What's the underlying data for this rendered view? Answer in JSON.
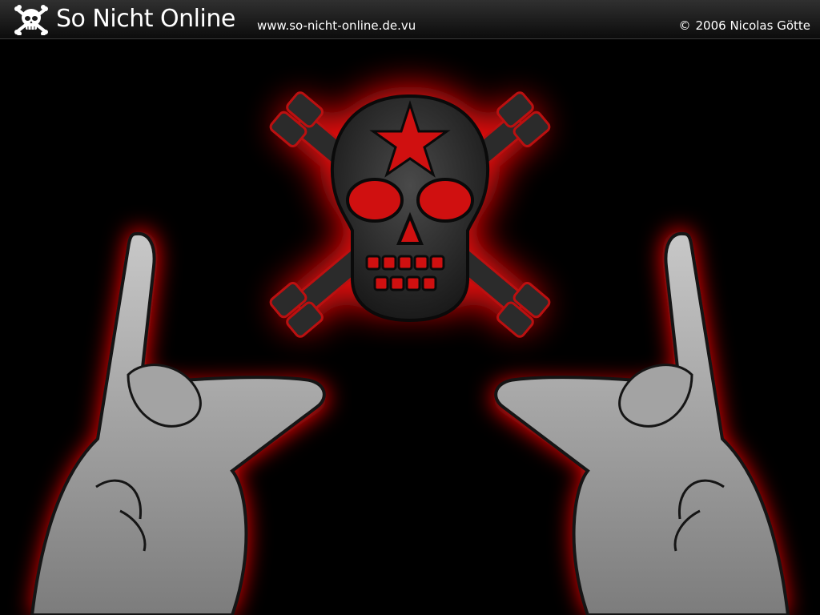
{
  "header": {
    "title": "So Nicht Online",
    "url": "www.so-nicht-online.de.vu",
    "copyright_symbol": "©",
    "copyright": "2006 Nicolas Götte",
    "logo_icon": "skull-crossbones-icon"
  },
  "artwork": {
    "icons": [
      "skull-crossbones-icon",
      "star-icon",
      "devil-horns-hand-icon"
    ],
    "colors": {
      "background": "#000000",
      "glow": "#ff1a1a",
      "skull": "#3a3a3a",
      "hand": "#9a9a9a",
      "outline": "#111111"
    }
  }
}
